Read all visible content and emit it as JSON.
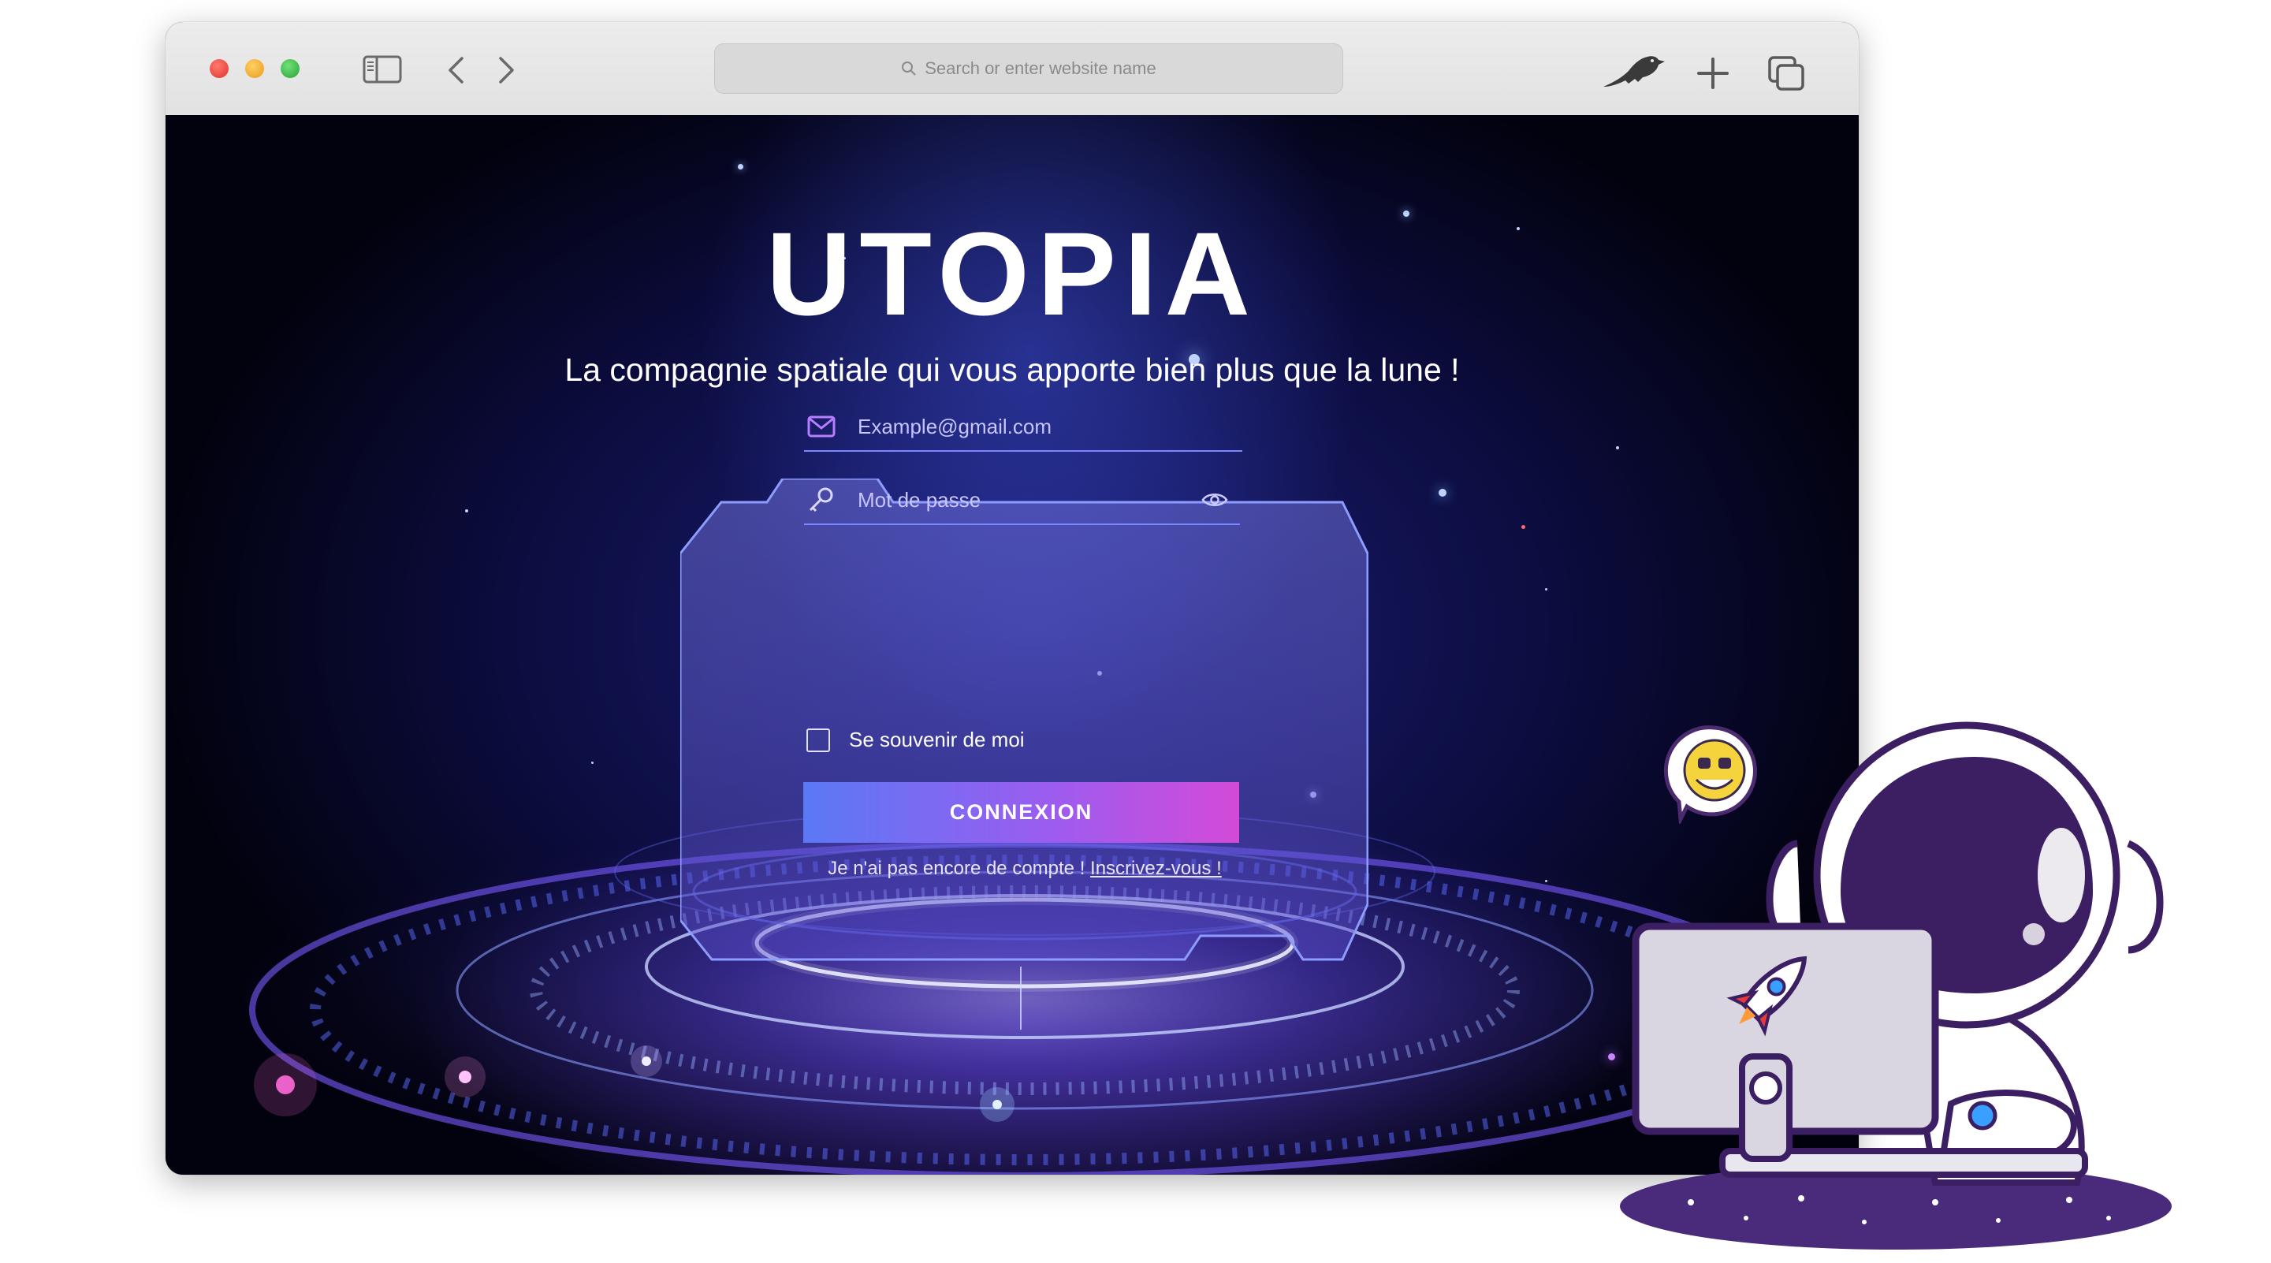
{
  "browser": {
    "url_placeholder": "Search or enter website name",
    "icons": [
      "sidebar-icon",
      "back-arrow-icon",
      "forward-arrow-icon",
      "search-icon",
      "crow-icon",
      "plus-icon",
      "tabs-overview-icon"
    ]
  },
  "hero": {
    "brand": "UTOPIA",
    "tagline": "La compagnie spatiale qui vous apporte bien plus que la lune !"
  },
  "login": {
    "email_placeholder": "Example@gmail.com",
    "password_placeholder": "Mot de passe",
    "remember_label": "Se souvenir de moi",
    "submit_label": "CONNEXION",
    "signup_text": "Je n'ai pas encore de compte !",
    "signup_link": "Inscrivez-vous !",
    "icons": [
      "envelope-icon",
      "key-icon",
      "eye-icon"
    ]
  },
  "colors": {
    "accent_start": "#5a79f5",
    "accent_end": "#d44ad8",
    "field_line": "#7b86ff",
    "mascot_purple": "#3c1e62"
  }
}
